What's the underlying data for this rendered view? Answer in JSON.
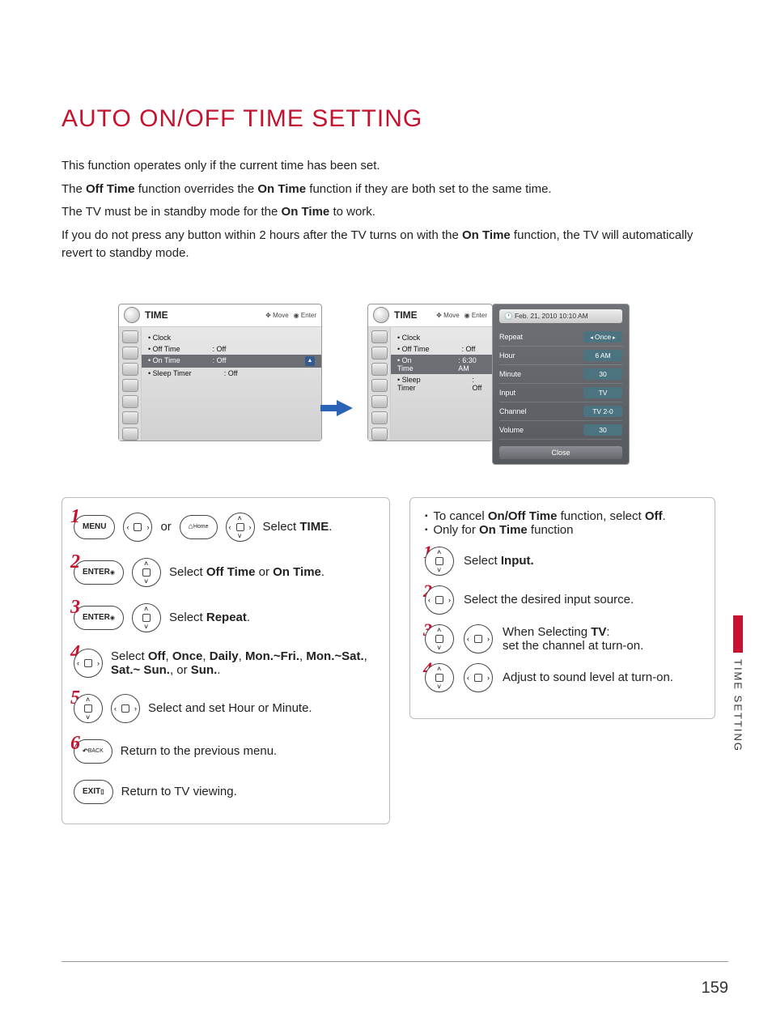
{
  "title": "AUTO ON/OFF TIME SETTING",
  "intro": {
    "p1": "This function operates only if the current time has been set.",
    "p2a": "The ",
    "p2b": "Off Time",
    "p2c": " function overrides the ",
    "p2d": "On Time",
    "p2e": " function if they are both set to the same time.",
    "p3a": "The TV must be in standby mode for the ",
    "p3b": "On Time",
    "p3c": " to work.",
    "p4a": "If you do not press any button within 2 hours after the TV turns on with the ",
    "p4b": "On Time",
    "p4c": " function, the TV will automatically revert to standby mode."
  },
  "osd": {
    "title": "TIME",
    "hints_move": "Move",
    "hints_enter": "Enter",
    "items": {
      "clock": "Clock",
      "off_time": "Off Time",
      "on_time": "On Time",
      "sleep_timer": "Sleep Timer"
    },
    "left_vals": {
      "off_time": ": Off",
      "on_time": ": Off",
      "sleep_timer": ": Off"
    },
    "right_vals": {
      "off_time": ": Off",
      "on_time": ": 6:30 AM",
      "sleep_timer": ": Off"
    },
    "detail": {
      "date": "Feb. 21, 2010 10:10 AM",
      "repeat_l": "Repeat",
      "repeat_v": "Once",
      "hour_l": "Hour",
      "hour_v": "6 AM",
      "minute_l": "Minute",
      "minute_v": "30",
      "input_l": "Input",
      "input_v": "TV",
      "channel_l": "Channel",
      "channel_v": "TV 2-0",
      "volume_l": "Volume",
      "volume_v": "30",
      "close": "Close"
    }
  },
  "buttons": {
    "menu": "MENU",
    "home": "Home",
    "enter": "ENTER",
    "back": "BACK",
    "exit": "EXIT"
  },
  "steps": {
    "or": "or",
    "s1a": "Select ",
    "s1b": "TIME",
    "s1c": ".",
    "s2a": "Select ",
    "s2b": "Off Time",
    "s2c": " or ",
    "s2d": "On Time",
    "s2e": ".",
    "s3a": "Select ",
    "s3b": "Repeat",
    "s3c": ".",
    "s4a": "Select ",
    "s4b": "Off",
    "s4c": ", ",
    "s4d": "Once",
    "s4e": ", ",
    "s4f": "Daily",
    "s4g": ", ",
    "s4h": "Mon.~Fri.",
    "s4i": ", ",
    "s4j": "Mon.~Sat.",
    "s4k": ", ",
    "s4l": "Sat.~ Sun.",
    "s4m": ", or ",
    "s4n": "Sun.",
    "s4o": ".",
    "s5": "Select and set Hour or Minute.",
    "s6": "Return to the previous menu.",
    "s7": "Return to TV viewing."
  },
  "notes": {
    "n1a": "To cancel ",
    "n1b": "On/Off Time",
    "n1c": " function, select ",
    "n1d": "Off",
    "n1e": ".",
    "n2a": "Only for ",
    "n2b": "On Time",
    "n2c": " function",
    "m1a": "Select ",
    "m1b": "Input.",
    "m2": "Select the desired input source.",
    "m3a": "When Selecting ",
    "m3b": "TV",
    "m3c": ":",
    "m3d": "set the channel at turn-on.",
    "m4": "Adjust to sound level at turn-on."
  },
  "side_tab": "TIME SETTING",
  "page_number": "159"
}
